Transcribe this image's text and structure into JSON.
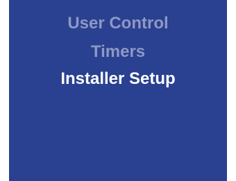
{
  "menu": {
    "items": [
      {
        "label": "User Control",
        "selected": false
      },
      {
        "label": "Timers",
        "selected": false
      },
      {
        "label": "Installer Setup",
        "selected": true
      }
    ]
  },
  "colors": {
    "background": "#2a4090",
    "item_text": "#8d98c5",
    "selected_text": "#ffffff"
  }
}
